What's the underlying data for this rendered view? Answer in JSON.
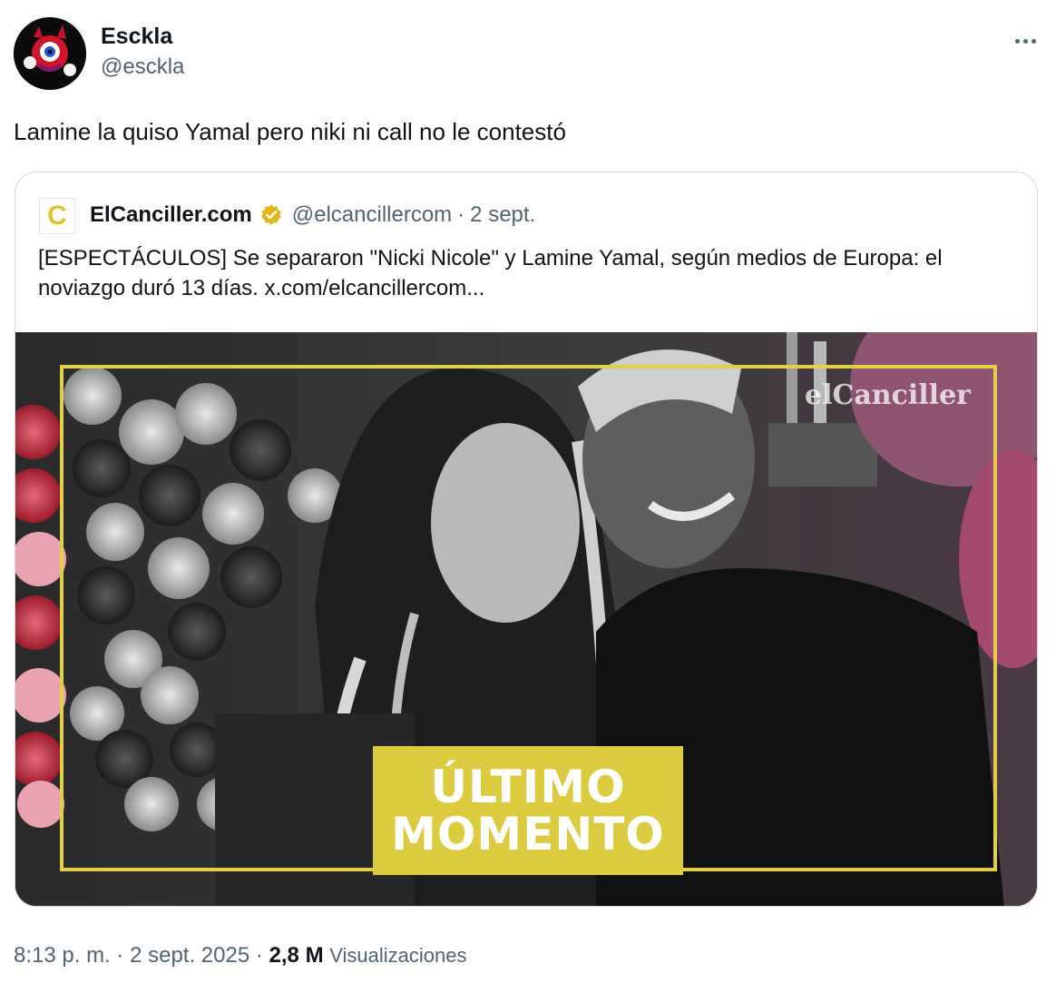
{
  "author": {
    "display_name": "Esckla",
    "handle": "@esckla"
  },
  "tweet": {
    "text": "Lamine la quiso Yamal pero niki ni call no le contestó"
  },
  "quote": {
    "logo_letter": "C",
    "name": "ElCanciller.com",
    "handle": "@elcancillercom",
    "separator": "·",
    "date": "2 sept.",
    "text": "[ESPECTÁCULOS] Se separaron \"Nicki Nicole\" y Lamine Yamal, según medios de Europa: el noviazgo duró 13 días.  x.com/elcancillercom...",
    "media": {
      "watermark": "elCanciller",
      "banner_line1": "ÚLTIMO",
      "banner_line2": "MOMENTO",
      "accent_color": "#dccb3f"
    }
  },
  "footer": {
    "time": "8:13 p. m.",
    "separator": "·",
    "date": "2 sept. 2025",
    "separator2": "·",
    "views_count": "2,8 M",
    "views_label": "Visualizaciones"
  },
  "colors": {
    "text_primary": "#0f1419",
    "text_secondary": "#536471",
    "border": "#cfd9de",
    "verified_gold": "#e2b719"
  }
}
